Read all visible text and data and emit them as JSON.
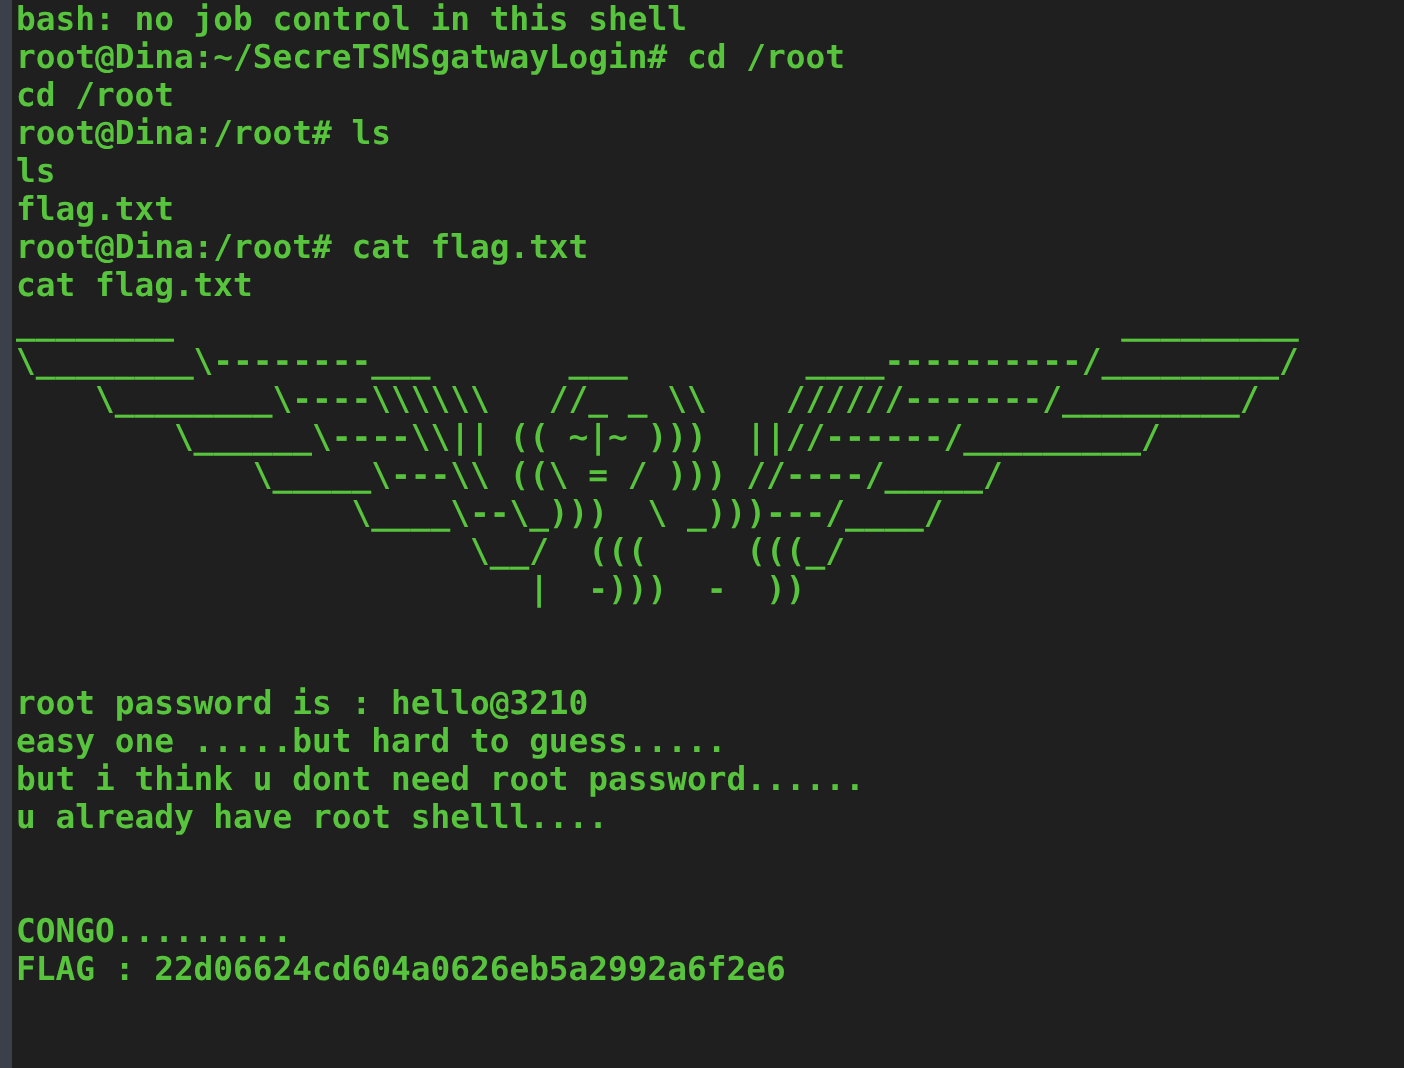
{
  "terminal": {
    "blocks": [
      {
        "lines": [
          "bash: no job control in this shell",
          "root@Dina:~/SecreTSMSgatwayLogin# cd /root",
          "cd /root",
          "root@Dina:/root# ls",
          "ls",
          "flag.txt",
          "root@Dina:/root# cat flag.txt",
          "cat flag.txt",
          "________                                                _________",
          "\\________\\--------___       ___         ____----------/_________/",
          "    \\________\\----\\\\\\\\\\\\   //_ _ \\\\    //////-------/_________/",
          "        \\______\\----\\\\|| (( ~|~ )))  ||//------/_________/",
          "            \\_____\\---\\\\ ((\\ = / ))) //----/_____/",
          "                 \\____\\--\\_)))  \\ _)))---/____/",
          "                       \\__/  (((     (((_/",
          "                          |  -)))  -  ))"
        ]
      },
      {
        "lines": [
          "root password is : hello@3210",
          "easy one .....but hard to guess.....",
          "but i think u dont need root password......",
          "u already have root shelll...."
        ]
      },
      {
        "lines": [
          "CONGO.........",
          "FLAG : 22d06624cd604a0626eb5a2992a6f2e6"
        ]
      }
    ]
  }
}
